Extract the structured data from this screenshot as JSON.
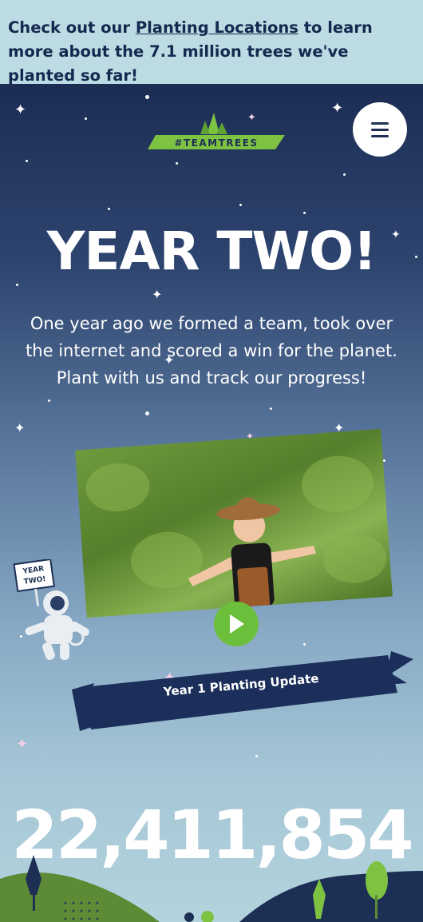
{
  "banner": {
    "prefix": "Check out our ",
    "link_label": "Planting Locations",
    "suffix": " to learn more about the 7.1 million trees we've planted so far!"
  },
  "header": {
    "logo_text": "#TEAMTREES",
    "menu_icon": "hamburger-menu-icon"
  },
  "hero": {
    "headline": "YEAR TWO!",
    "intro": "One year ago we formed a team, took over the internet and scored a win for the planet. Plant with us and track our progress!"
  },
  "video": {
    "ribbon_label": "Year 1 Planting Update",
    "play_icon": "play-icon",
    "sign_text_line1": "YEAR",
    "sign_text_line2": "TWO!"
  },
  "counter": {
    "value": "22,411,854"
  },
  "colors": {
    "navy": "#1d2f55",
    "banner_bg": "#bcdbe2",
    "accent_green": "#6cbf3a",
    "logo_green": "#7ec242"
  }
}
